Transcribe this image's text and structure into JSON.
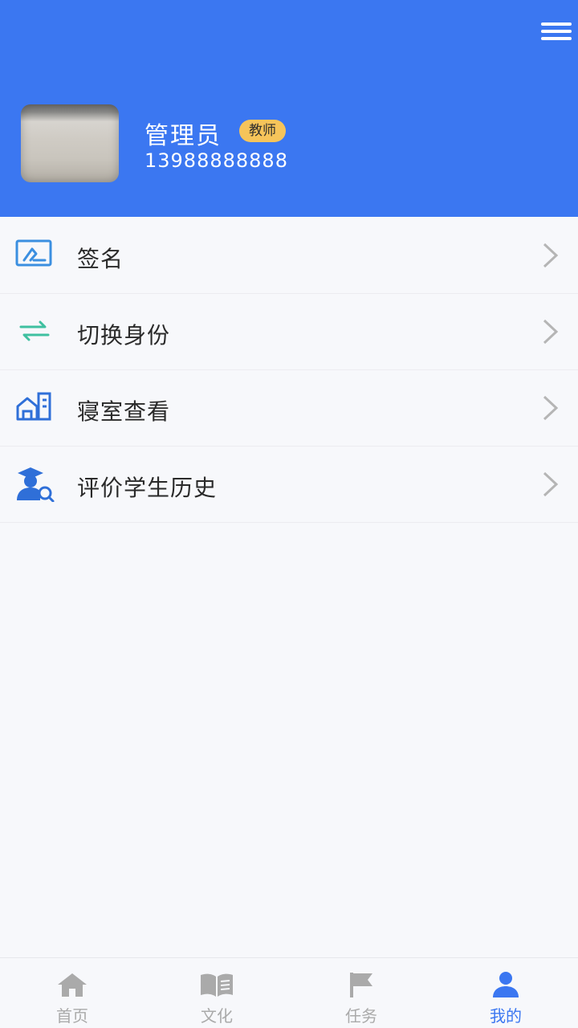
{
  "header": {
    "menu_icon": "hamburger-menu-icon",
    "user": {
      "name": "管理员",
      "role": "教师",
      "phone": "13988888888"
    },
    "colors": {
      "background": "#3b77f1",
      "badge": "#f6c45a"
    }
  },
  "menu": {
    "items": [
      {
        "label": "签名",
        "icon": "signature-icon"
      },
      {
        "label": "切换身份",
        "icon": "switch-arrows-icon"
      },
      {
        "label": "寝室查看",
        "icon": "dormitory-icon"
      },
      {
        "label": "评价学生历史",
        "icon": "student-search-icon"
      }
    ]
  },
  "tabbar": {
    "tabs": [
      {
        "label": "首页",
        "icon": "home-icon",
        "active": false
      },
      {
        "label": "文化",
        "icon": "book-icon",
        "active": false
      },
      {
        "label": "任务",
        "icon": "flag-icon",
        "active": false
      },
      {
        "label": "我的",
        "icon": "person-icon",
        "active": true
      }
    ],
    "colors": {
      "active": "#3b77f1",
      "inactive": "#aaaaaa"
    }
  }
}
